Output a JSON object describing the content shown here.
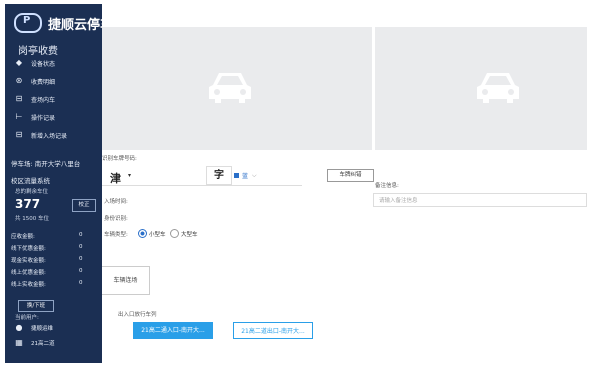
{
  "sidebar": {
    "brand": "捷顺云停车",
    "section_title": "岗亭收费",
    "menu": [
      {
        "icon": "diamond-icon",
        "label": "设备状态"
      },
      {
        "icon": "coin-icon",
        "label": "收费明细"
      },
      {
        "icon": "car-icon",
        "label": "查场内车"
      },
      {
        "icon": "flag-icon",
        "label": "操作记录"
      },
      {
        "icon": "car-icon",
        "label": "新增入场记录"
      }
    ],
    "parking_lot": "停车场: 南开大学八里台",
    "campus": "校区流量系统",
    "remaining_label": "总的剩余车位",
    "remaining_count": "377",
    "correct_button": "校正",
    "total": "共 1500 车位",
    "stats": [
      {
        "label": "应收金额:",
        "value": "0"
      },
      {
        "label": "线下优惠金额:",
        "value": "0"
      },
      {
        "label": "现金实收金额:",
        "value": "0"
      },
      {
        "label": "线上优惠金额:",
        "value": "0"
      },
      {
        "label": "线上实收金额:",
        "value": "0"
      }
    ],
    "shift_button": "换/下班",
    "current_user_label": "当前用户:",
    "user": "捷顺运维",
    "lane": "21高二道"
  },
  "form": {
    "plate_label": "识别车牌号码:",
    "province": "津",
    "char": "字",
    "color": "蓝",
    "edit_button": "车牌纠错",
    "note_label": "备注信息:",
    "note_placeholder": "请输入备注信息",
    "enter_time_label": "入场时间:",
    "identity_label": "身份识别:",
    "vehicle_type_label": "车辆类型:",
    "types": [
      "小型车",
      "大型车"
    ]
  },
  "lanes": {
    "switch_button": "车辆连场",
    "title": "出入口放行车列",
    "items": [
      "21高二通入口-南开大...",
      "21高二道出口-南开大..."
    ]
  }
}
